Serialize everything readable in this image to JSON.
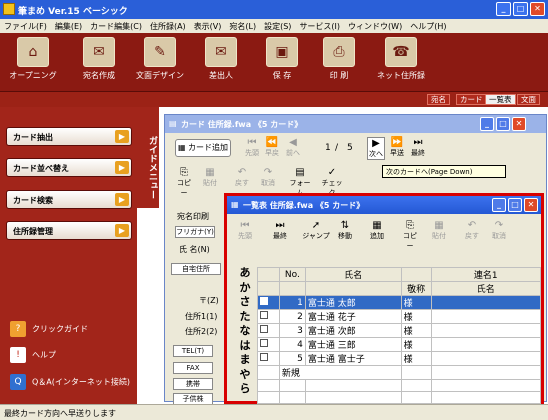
{
  "app": {
    "title": "筆まめ Ver.15 ベーシック"
  },
  "menu": [
    "ファイル(F)",
    "編集(E)",
    "カード編集(C)",
    "住所録(A)",
    "表示(V)",
    "宛名(L)",
    "設定(S)",
    "サービス(I)",
    "ウィンドウ(W)",
    "ヘルプ(H)"
  ],
  "toolbar": [
    {
      "label": "オープニング",
      "icon": "opening-icon"
    },
    {
      "label": "宛名作成",
      "icon": "address-create-icon"
    },
    {
      "label": "文面デザイン",
      "icon": "design-icon"
    },
    {
      "label": "差出人",
      "icon": "sender-icon"
    },
    {
      "label": "保 存",
      "icon": "save-icon"
    },
    {
      "label": "印 刷",
      "icon": "print-icon"
    },
    {
      "label": "ネット住所録",
      "icon": "net-address-book-icon"
    }
  ],
  "modes": [
    "宛名",
    "カード",
    "一覧表",
    "文面"
  ],
  "guide": {
    "tab_label": "ガイドメニュー",
    "buttons": [
      "カード抽出",
      "カード並べ替え",
      "カード検索",
      "住所録管理"
    ],
    "links": [
      {
        "label": "クリックガイド",
        "icon": "question-icon"
      },
      {
        "label": "ヘルプ",
        "icon": "help-icon"
      },
      {
        "label": "Q＆A(インターネット接続)",
        "icon": "qa-icon"
      }
    ]
  },
  "card_window": {
    "title": "カード  住所録.fwa   《5 カード》",
    "add_card": "カード追加",
    "nav": [
      "先頭",
      "早戻",
      "前へ",
      "次へ",
      "早送",
      "最終"
    ],
    "page": "1",
    "total": "5",
    "tools": [
      "コピー",
      "貼付",
      "戻す",
      "取消",
      "フォーム",
      "チェック"
    ],
    "tooltip": "次のカードへ(Page Down)",
    "fields": {
      "print_label": "宛名印刷",
      "furigana": "フリガナ(Y)",
      "name": "氏 名(N)",
      "home_tab": "自宅住所",
      "zip": "〒(Z)",
      "addr1": "住所1(1)",
      "addr2": "住所2(2)",
      "tel": "TEL(T)",
      "fax": "FAX",
      "mobile": "携帯",
      "email": "子供株"
    }
  },
  "list_window": {
    "title": "一覧表  住所録.fwa   《5 カード》",
    "tools": [
      "先頭",
      "最終",
      "ジャンプ",
      "移動",
      "追加",
      "コピー",
      "貼付",
      "戻す",
      "取消"
    ],
    "kana": [
      "あ",
      "か",
      "さ",
      "た",
      "な",
      "は",
      "ま",
      "や",
      "ら"
    ],
    "headers": {
      "no": "No.",
      "name": "氏名",
      "title": "敬称",
      "joint": "連名1",
      "joint_name": "氏名"
    },
    "rows": [
      {
        "no": "1",
        "name": "富士通  太郎",
        "title": "様"
      },
      {
        "no": "2",
        "name": "富士通  花子",
        "title": "様"
      },
      {
        "no": "3",
        "name": "富士通  次郎",
        "title": "様"
      },
      {
        "no": "4",
        "name": "富士通  三郎",
        "title": "様"
      },
      {
        "no": "5",
        "name": "富士通  富士子",
        "title": "様"
      }
    ],
    "new_row": "新規"
  },
  "status": {
    "text": "最終カード方向へ早送りします"
  }
}
